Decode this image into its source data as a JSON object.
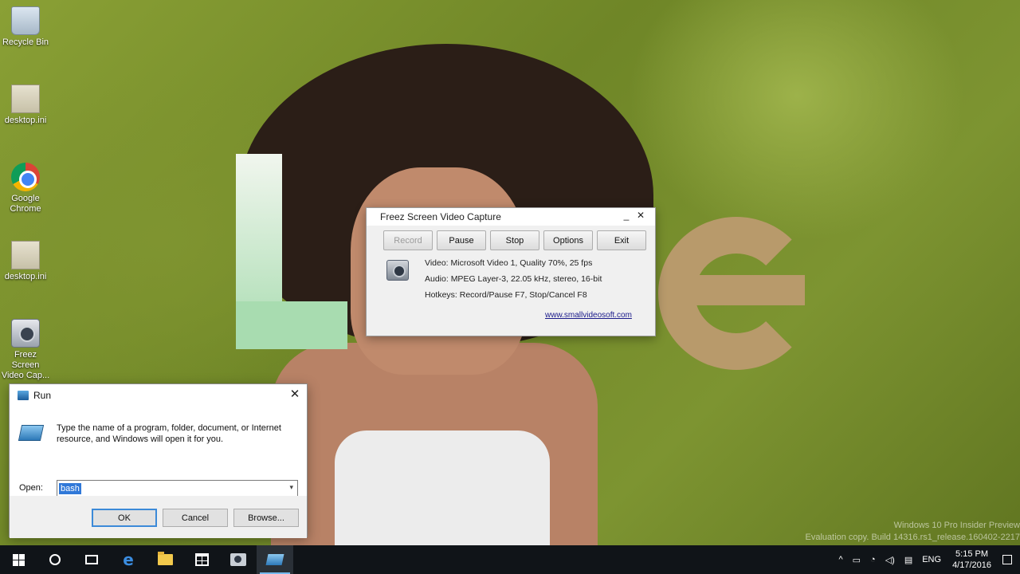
{
  "desktop": {
    "icons": [
      {
        "label": "Recycle Bin",
        "icon": "recycle-bin-icon"
      },
      {
        "label": "desktop.ini",
        "icon": "file-icon"
      },
      {
        "label": "Google Chrome",
        "icon": "chrome-icon"
      },
      {
        "label": "desktop.ini",
        "icon": "file-icon"
      },
      {
        "label": "Freez Screen Video Cap...",
        "icon": "camera-icon"
      }
    ],
    "watermark": {
      "line1": "Windows 10 Pro Insider Preview",
      "line2": "Evaluation copy. Build 14316.rs1_release.160402-2217"
    }
  },
  "freez": {
    "title": "Freez Screen Video Capture",
    "minimize": "_",
    "close": "✕",
    "buttons": {
      "record": "Record",
      "pause": "Pause",
      "stop": "Stop",
      "options": "Options",
      "exit": "Exit"
    },
    "record_enabled": false,
    "video": "Video: Microsoft Video 1, Quality 70%, 25 fps",
    "audio": "Audio: MPEG Layer-3, 22.05 kHz, stereo, 16-bit",
    "hotkeys": "Hotkeys: Record/Pause F7, Stop/Cancel F8",
    "link": "www.smallvideosoft.com"
  },
  "run": {
    "title": "Run",
    "close": "✕",
    "description": "Type the name of a program, folder, document, or Internet resource, and Windows will open it for you.",
    "open_label": "Open:",
    "open_value": "bash",
    "dropdown_caret": "▾",
    "buttons": {
      "ok": "OK",
      "cancel": "Cancel",
      "browse": "Browse..."
    }
  },
  "taskbar": {
    "tray": {
      "up_arrow": "^",
      "language": "ENG",
      "time": "5:15 PM",
      "date": "4/17/2016"
    },
    "accent": "#76b9ed"
  }
}
